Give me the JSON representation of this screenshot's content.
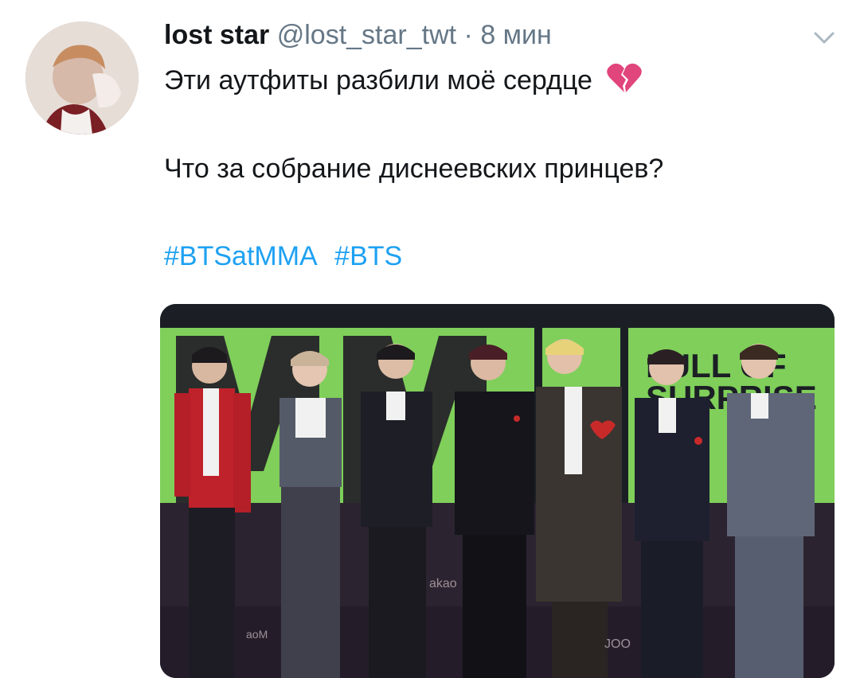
{
  "tweet": {
    "author": {
      "display_name": "lost star",
      "handle": "@lost_star_twt",
      "separator": "·",
      "time": "8 мин"
    },
    "text_line_1": "Эти аутфиты разбили моё сердце",
    "text_line_1_emoji": "broken-heart-icon",
    "text_line_2": "Что за собрание диснеевских принцев?",
    "hashtags": [
      "#BTSatMMA",
      "#BTS"
    ],
    "media": {
      "backdrop_text": [
        "FULL OF",
        "SURPRISE"
      ],
      "backdrop_color": "#7fcf5a",
      "floor_watermarks": [
        "akao",
        "JOO",
        "aoM"
      ]
    }
  },
  "colors": {
    "hashtag": "#1da1f2",
    "muted": "#657786",
    "text": "#14171a",
    "heart": "#e0457b"
  }
}
